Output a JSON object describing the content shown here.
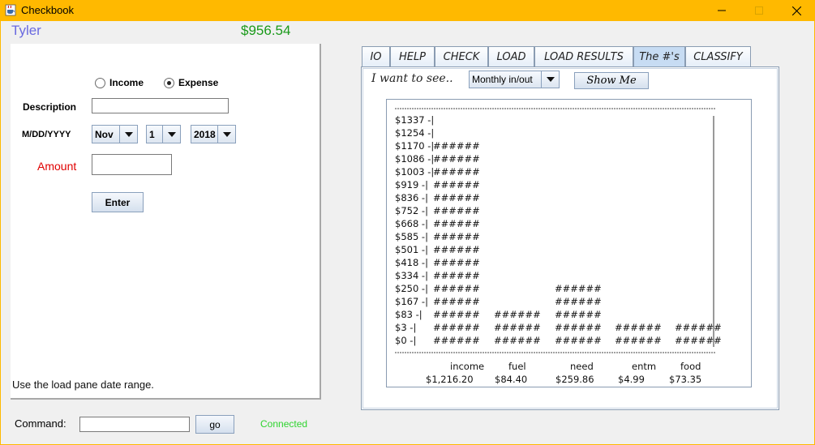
{
  "window": {
    "title": "Checkbook",
    "app_icon": "java-cup-icon",
    "controls": [
      "minimize-icon",
      "maximize-icon",
      "close-icon"
    ],
    "title_bar_color": "#ffb900"
  },
  "header": {
    "user_name": "Tyler",
    "balance": "$956.54",
    "user_color": "#6a6ae0",
    "balance_color": "#1a9a1a"
  },
  "form": {
    "type_options": [
      {
        "label": "Income",
        "selected": false
      },
      {
        "label": "Expense",
        "selected": true
      }
    ],
    "description_label": "Description",
    "description_value": "",
    "date_label": "M/DD/YYYY",
    "month": "Nov",
    "day": "1",
    "year": "2018",
    "amount_label": "Amount",
    "amount_label_color": "#e00000",
    "amount_value": "",
    "enter_label": "Enter",
    "hint": "Use the load pane date range."
  },
  "command_bar": {
    "label": "Command:",
    "value": "",
    "go_label": "go",
    "status": "Connected",
    "status_color": "#2fd42f"
  },
  "tabs": [
    {
      "label": "IO",
      "active": false
    },
    {
      "label": "HELP",
      "active": false
    },
    {
      "label": "CHECK",
      "active": false
    },
    {
      "label": "LOAD",
      "active": false
    },
    {
      "label": "LOAD RESULTS",
      "active": false
    },
    {
      "label": "The #'s",
      "active": true
    },
    {
      "label": "CLASSIFY",
      "active": false
    }
  ],
  "numbers_tab": {
    "want_label": "I want to see..",
    "view_select": "Monthly in/out",
    "show_me_label": "Show Me"
  },
  "chart_data": {
    "type": "bar",
    "rendering": "ascii",
    "bar_glyph": "######",
    "y_tick_labels": [
      "$1337",
      "$1254",
      "$1170",
      "$1086",
      "$1003",
      "$919",
      "$836",
      "$752",
      "$668",
      "$585",
      "$501",
      "$418",
      "$334",
      "$250",
      "$167",
      "$83",
      "$3",
      "$0"
    ],
    "categories": [
      "income",
      "fuel",
      "need",
      "entm",
      "food"
    ],
    "amount_labels": [
      "$1,216.20",
      "$84.40",
      "$259.86",
      "$4.99",
      "$73.35"
    ],
    "values": [
      1216.2,
      84.4,
      259.86,
      4.99,
      73.35
    ],
    "ylim": [
      0,
      1337
    ]
  }
}
